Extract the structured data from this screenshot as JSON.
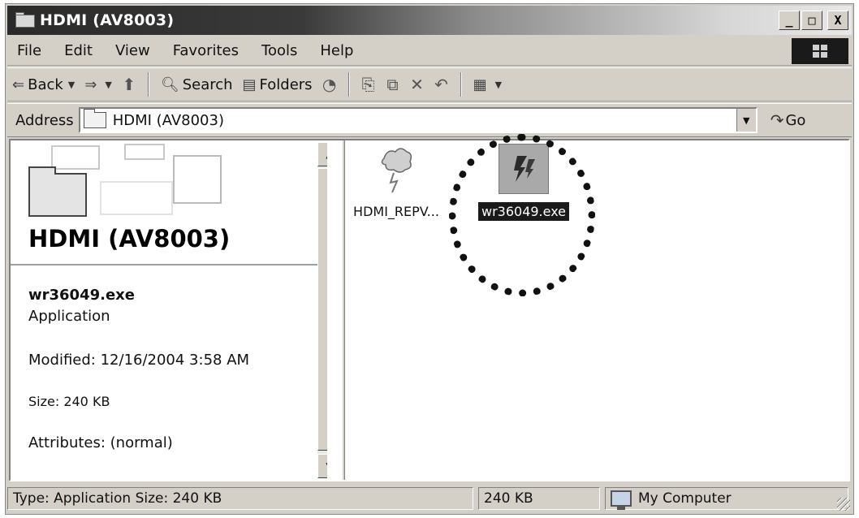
{
  "window": {
    "title": "HDMI (AV8003)",
    "buttons": [
      "_",
      "□",
      "X"
    ]
  },
  "menu": {
    "items": [
      "File",
      "Edit",
      "View",
      "Favorites",
      "Tools",
      "Help"
    ]
  },
  "toolbar": {
    "back": "Back",
    "search": "Search",
    "folders": "Folders",
    "icons": [
      "back-arrow-icon",
      "forward-arrow-icon",
      "up-folder-icon",
      "search-icon",
      "folders-icon",
      "history-icon",
      "move-to-icon",
      "copy-to-icon",
      "delete-icon",
      "undo-icon",
      "views-icon"
    ]
  },
  "address": {
    "label": "Address",
    "value": "HDMI (AV8003)",
    "go": "Go"
  },
  "left_pane": {
    "folder_title": "HDMI (AV8003)",
    "selected_name": "wr36049.exe",
    "selected_type": "Application",
    "modified": "Modified: 12/16/2004 3:58 AM",
    "size": "Size: 240 KB",
    "attributes": "Attributes: (normal)"
  },
  "files": [
    {
      "name": "HDMI_REPV...",
      "icon": "document-icon",
      "selected": false
    },
    {
      "name": "wr36049.exe",
      "icon": "application-icon",
      "selected": true
    }
  ],
  "status": {
    "left": "Type: Application Size: 240 KB",
    "middle": "240 KB",
    "right": "My Computer"
  },
  "colors": {
    "window_bg": "#d4d0c8",
    "selection": "#1a1a1a"
  }
}
